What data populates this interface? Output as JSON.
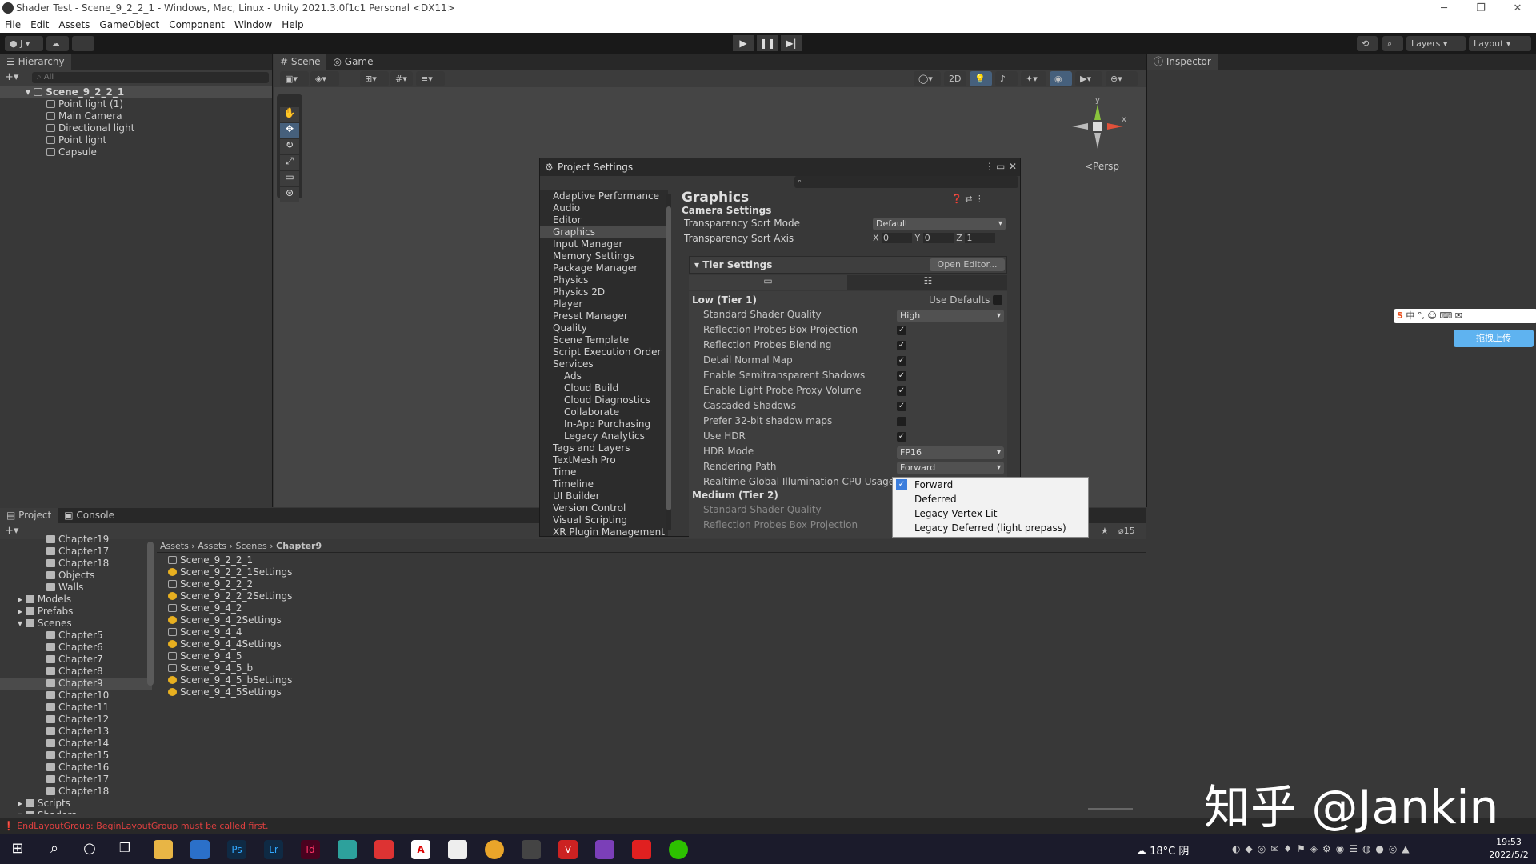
{
  "window": {
    "title": "Shader Test - Scene_9_2_2_1 - Windows, Mac, Linux - Unity 2021.3.0f1c1 Personal <DX11>"
  },
  "menu": [
    "File",
    "Edit",
    "Assets",
    "GameObject",
    "Component",
    "Window",
    "Help"
  ],
  "toolbar": {
    "account": "J",
    "layers": "Layers",
    "layout": "Layout"
  },
  "hierarchy": {
    "tab": "Hierarchy",
    "search_placeholder": "All",
    "scene": "Scene_9_2_2_1",
    "items": [
      "Point light (1)",
      "Main Camera",
      "Directional light",
      "Point light",
      "Capsule"
    ]
  },
  "scene_view": {
    "tabs": [
      "Scene",
      "Game"
    ],
    "mode_2d": "2D",
    "persp": "<Persp",
    "axes": {
      "y": "y",
      "x": "x"
    }
  },
  "inspector": {
    "tab": "Inspector"
  },
  "project_settings": {
    "title": "Project Settings",
    "nav": [
      "Adaptive Performance",
      "Audio",
      "Editor",
      "Graphics",
      "Input Manager",
      "Memory Settings",
      "Package Manager",
      "Physics",
      "Physics 2D",
      "Player",
      "Preset Manager",
      "Quality",
      "Scene Template",
      "Script Execution Order",
      "Services",
      "Ads",
      "Cloud Build",
      "Cloud Diagnostics",
      "Collaborate",
      "In-App Purchasing",
      "Legacy Analytics",
      "Tags and Layers",
      "TextMesh Pro",
      "Time",
      "Timeline",
      "UI Builder",
      "Version Control",
      "Visual Scripting",
      "XR Plugin Management"
    ],
    "heading": "Graphics",
    "camera_settings": "Camera Settings",
    "transparency_sort_mode": {
      "label": "Transparency Sort Mode",
      "value": "Default"
    },
    "transparency_sort_axis": {
      "label": "Transparency Sort Axis",
      "x": "0",
      "y": "0",
      "z": "1",
      "xl": "X",
      "yl": "Y",
      "zl": "Z"
    },
    "tier_settings": "Tier Settings",
    "open_editor": "Open Editor...",
    "low_tier": "Low (Tier 1)",
    "use_defaults": "Use Defaults",
    "rows": [
      {
        "label": "Standard Shader Quality",
        "value": "High"
      },
      {
        "label": "Reflection Probes Box Projection",
        "check": "✓"
      },
      {
        "label": "Reflection Probes Blending",
        "check": "✓"
      },
      {
        "label": "Detail Normal Map",
        "check": "✓"
      },
      {
        "label": "Enable Semitransparent Shadows",
        "check": "✓"
      },
      {
        "label": "Enable Light Probe Proxy Volume",
        "check": "✓"
      },
      {
        "label": "Cascaded Shadows",
        "check": "✓"
      },
      {
        "label": "Prefer 32-bit shadow maps",
        "check": ""
      },
      {
        "label": "Use HDR",
        "check": "✓"
      },
      {
        "label": "HDR Mode",
        "value": "FP16"
      },
      {
        "label": "Rendering Path",
        "value": "Forward"
      },
      {
        "label": "Realtime Global Illumination CPU Usage",
        "value": ""
      }
    ],
    "medium_tier": "Medium (Tier 2)",
    "medium_rows": [
      "Standard Shader Quality",
      "Reflection Probes Box Projection"
    ]
  },
  "dropdown": {
    "options": [
      "Forward",
      "Deferred",
      "Legacy Vertex Lit",
      "Legacy Deferred (light prepass)"
    ],
    "selected": "Forward"
  },
  "project": {
    "tabs": [
      "Project",
      "Console"
    ],
    "breadcrumb": [
      "Assets",
      "Assets",
      "Scenes",
      "Chapter9"
    ],
    "tree": [
      "Chapter19",
      "Chapter17",
      "Chapter18",
      "Objects",
      "Walls",
      "Models",
      "Prefabs",
      "Scenes",
      "Chapter5",
      "Chapter6",
      "Chapter7",
      "Chapter8",
      "Chapter9",
      "Chapter10",
      "Chapter11",
      "Chapter12",
      "Chapter13",
      "Chapter14",
      "Chapter15",
      "Chapter16",
      "Chapter17",
      "Chapter18",
      "Scripts",
      "Shaders"
    ],
    "files": [
      "Scene_9_2_2_1",
      "Scene_9_2_2_1Settings",
      "Scene_9_2_2_2",
      "Scene_9_2_2_2Settings",
      "Scene_9_4_2",
      "Scene_9_4_2Settings",
      "Scene_9_4_4",
      "Scene_9_4_4Settings",
      "Scene_9_4_5",
      "Scene_9_4_5_b",
      "Scene_9_4_5_bSettings",
      "Scene_9_4_5Settings"
    ],
    "hidden_count": "15"
  },
  "status": {
    "error": "EndLayoutGroup: BeginLayoutGroup must be called first."
  },
  "taskbar": {
    "weather": "18°C 阴",
    "time": "19:53",
    "date": "2022/5/2"
  },
  "watermark": "知乎 @Jankin",
  "ime": {
    "upload": "拖拽上传"
  }
}
